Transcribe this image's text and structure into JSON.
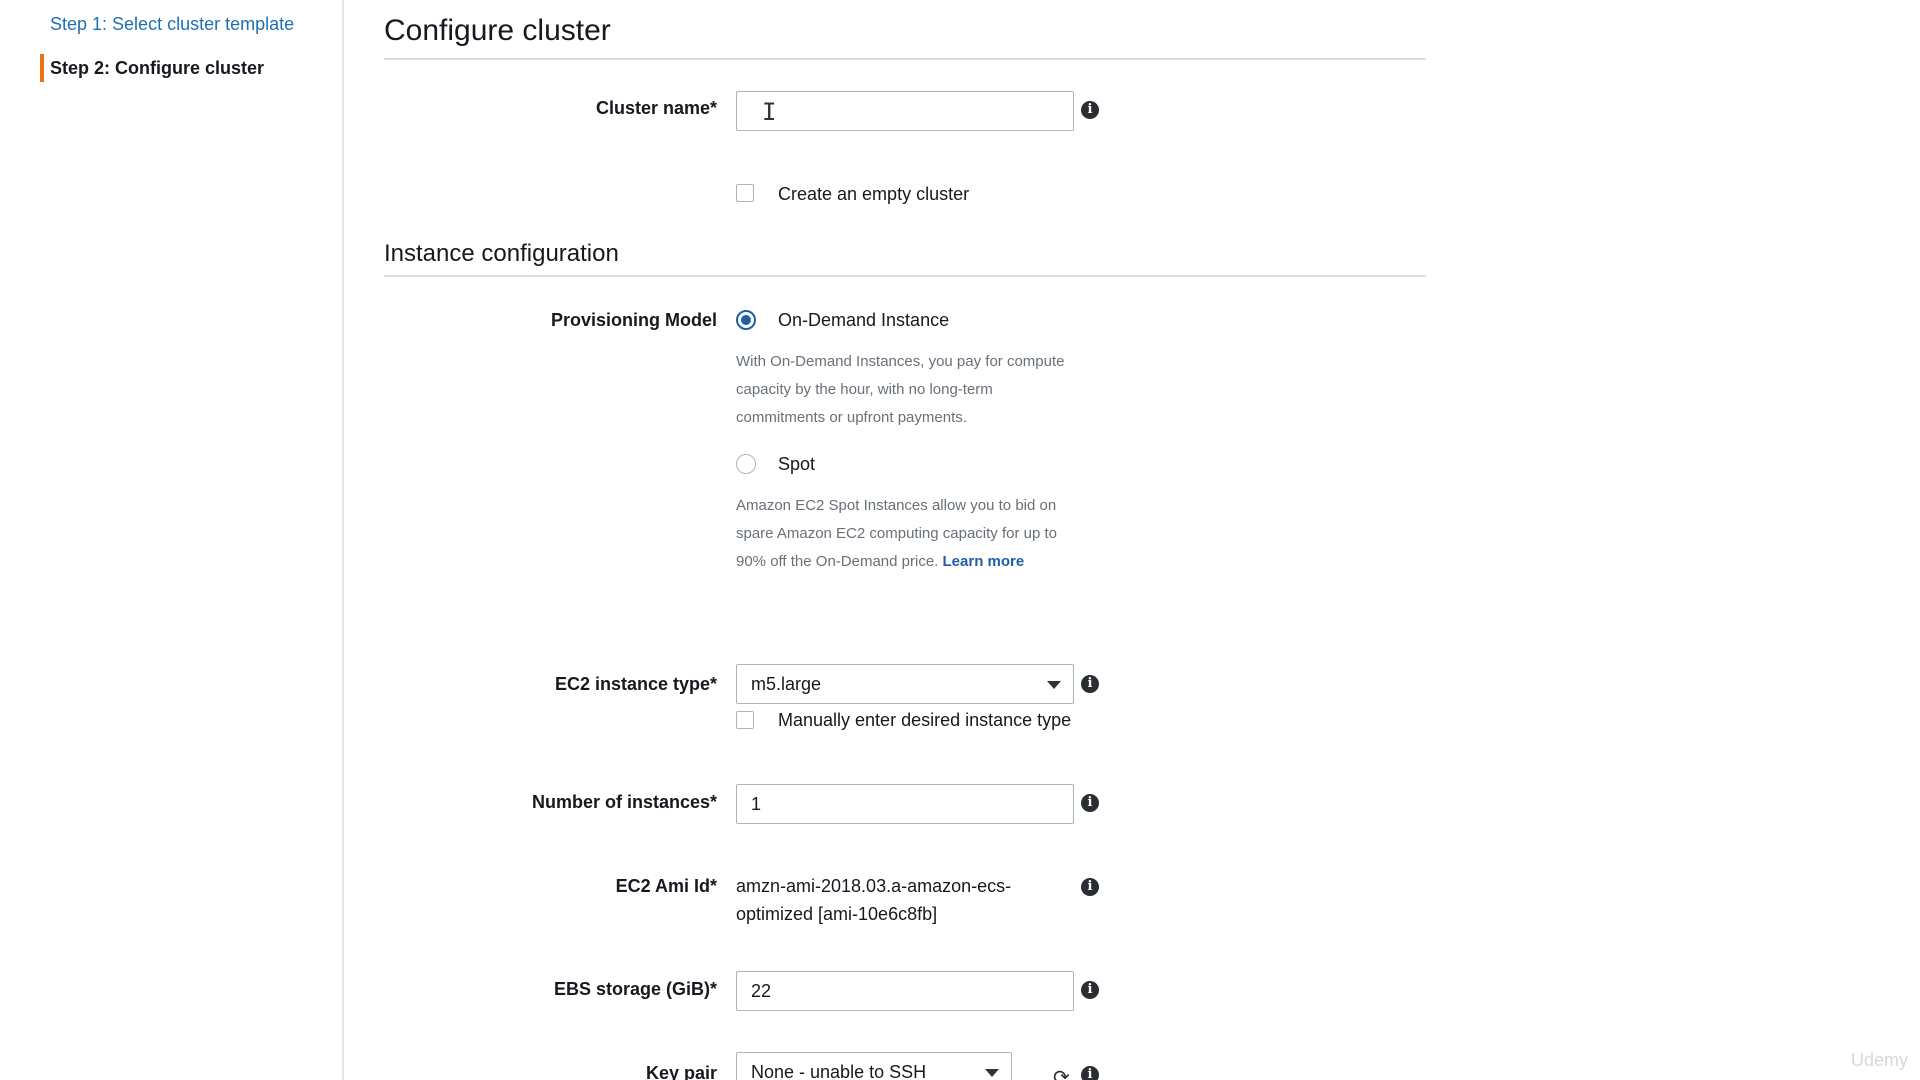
{
  "sidebar": {
    "steps": [
      {
        "label": "Step 1: Select cluster template"
      },
      {
        "label": "Step 2: Configure cluster"
      }
    ]
  },
  "main": {
    "title": "Configure cluster",
    "cluster_name": {
      "label": "Cluster name*",
      "value": ""
    },
    "empty_cluster": {
      "label": "Create an empty cluster",
      "checked": false
    },
    "instance_section_title": "Instance configuration",
    "provisioning": {
      "label": "Provisioning Model",
      "options": [
        {
          "label": "On-Demand Instance",
          "selected": true,
          "help": "With On-Demand Instances, you pay for compute capacity by the hour, with no long-term commitments or upfront payments."
        },
        {
          "label": "Spot",
          "selected": false,
          "help": "Amazon EC2 Spot Instances allow you to bid on spare Amazon EC2 computing capacity for up to 90% off the On-Demand price.",
          "link": "Learn more"
        }
      ]
    },
    "instance_type": {
      "label": "EC2 instance type*",
      "value": "m5.large",
      "manual_label": "Manually enter desired instance type"
    },
    "num_instances": {
      "label": "Number of instances*",
      "value": "1"
    },
    "ami": {
      "label": "EC2 Ami Id*",
      "value": "amzn-ami-2018.03.a-amazon-ecs-optimized [ami-10e6c8fb]"
    },
    "ebs": {
      "label": "EBS storage (GiB)*",
      "value": "22"
    },
    "key_pair": {
      "label": "Key pair",
      "value": "None - unable to SSH"
    }
  },
  "icons": {
    "info": "info-icon",
    "refresh": "refresh-icon",
    "dropdown": "chevron-down-icon"
  },
  "colors": {
    "accent": "#ec7211",
    "link": "#1f6fb5",
    "radio_selected": "#1f5fa8"
  },
  "watermark": "Udemy"
}
